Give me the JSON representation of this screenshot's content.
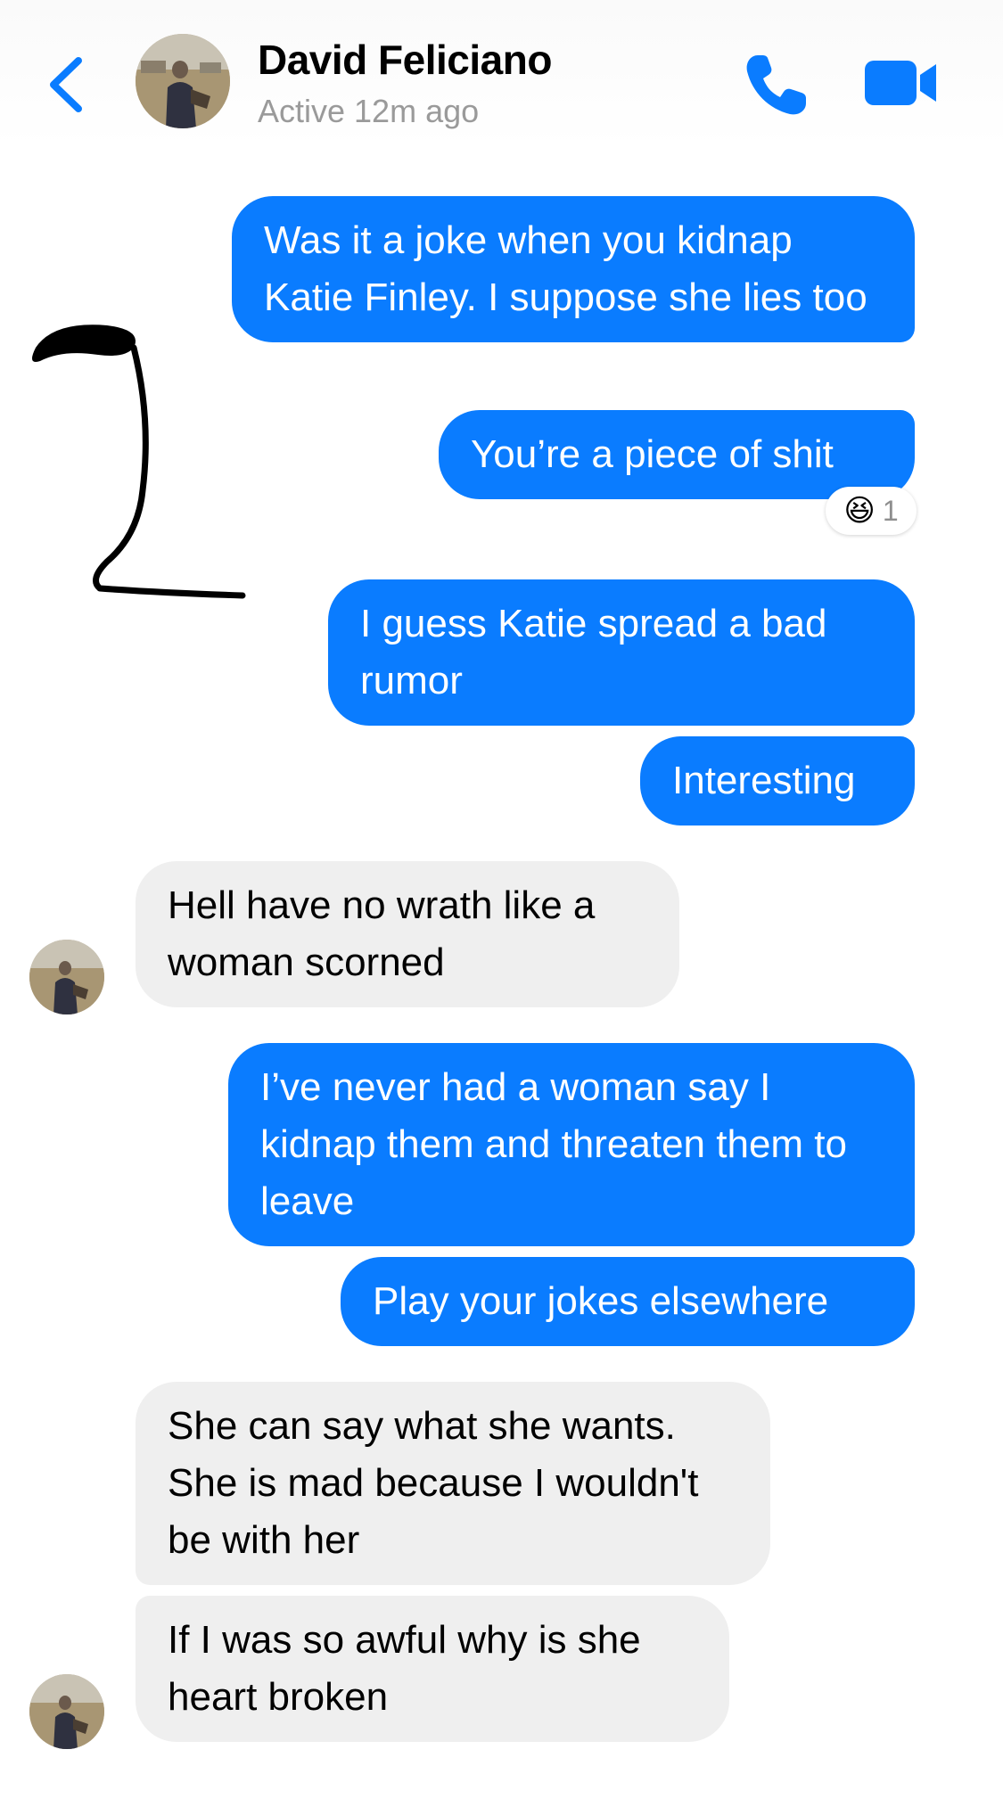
{
  "header": {
    "contact_name": "David Feliciano",
    "status": "Active 12m ago",
    "icons": [
      "chevron-left-icon",
      "phone-icon",
      "video-camera-icon"
    ]
  },
  "colors": {
    "accent": "#0a7cff",
    "outgoing_bubble": "#0a7cff",
    "incoming_bubble": "#efefef"
  },
  "messages": [
    {
      "sender": "me",
      "text": "Was it a joke when you kidnap Katie Finley. I suppose she lies too"
    },
    {
      "sender": "me",
      "text": "You’re a piece of shit",
      "reaction": {
        "emoji": "😆",
        "count": "1"
      }
    },
    {
      "sender": "me",
      "text": "I guess Katie spread a bad rumor"
    },
    {
      "sender": "me",
      "text": "Interesting"
    },
    {
      "sender": "them",
      "text": "Hell have no wrath like a woman scorned"
    },
    {
      "sender": "me",
      "text": "I’ve never had a woman say I kidnap them and threaten them to leave"
    },
    {
      "sender": "me",
      "text": "Play your jokes elsewhere"
    },
    {
      "sender": "them",
      "text": "She can say what she wants. She is mad because I wouldn't be with her"
    },
    {
      "sender": "them",
      "text": "If I was so awful why is she heart broken"
    }
  ]
}
